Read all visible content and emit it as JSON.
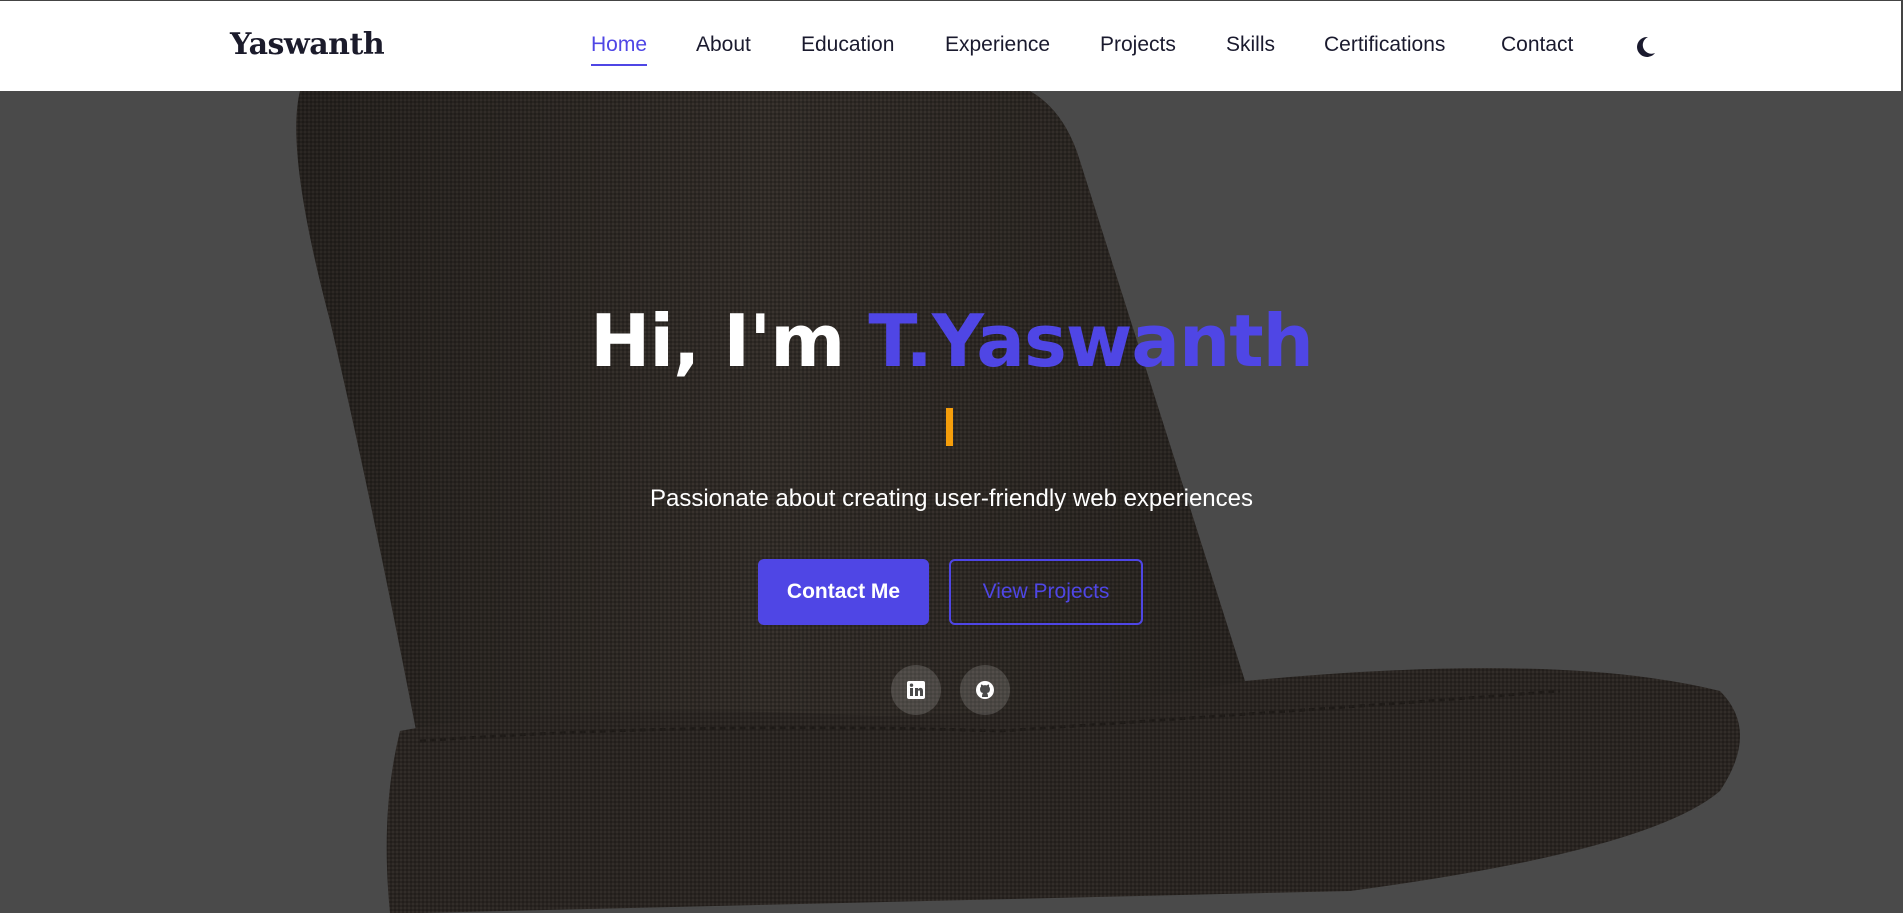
{
  "brand": {
    "name": "Yaswanth"
  },
  "nav": {
    "items": [
      {
        "label": "Home",
        "active": true
      },
      {
        "label": "About"
      },
      {
        "label": "Education"
      },
      {
        "label": "Experience"
      },
      {
        "label": "Projects"
      },
      {
        "label": "Skills"
      },
      {
        "label": "Certifications"
      },
      {
        "label": "Contact"
      }
    ],
    "theme_toggle_icon": "moon-icon"
  },
  "hero": {
    "greeting": "Hi, I'm ",
    "name": "T.Yaswanth",
    "tagline": "Passionate about creating user-friendly web experiences",
    "primary_button": "Contact Me",
    "secondary_button": "View Projects",
    "social": [
      {
        "icon": "linkedin-icon"
      },
      {
        "icon": "github-icon"
      }
    ]
  },
  "colors": {
    "accent": "#4f46e5",
    "cursor": "#f59e0b",
    "text_dark": "#1a1a2e"
  }
}
